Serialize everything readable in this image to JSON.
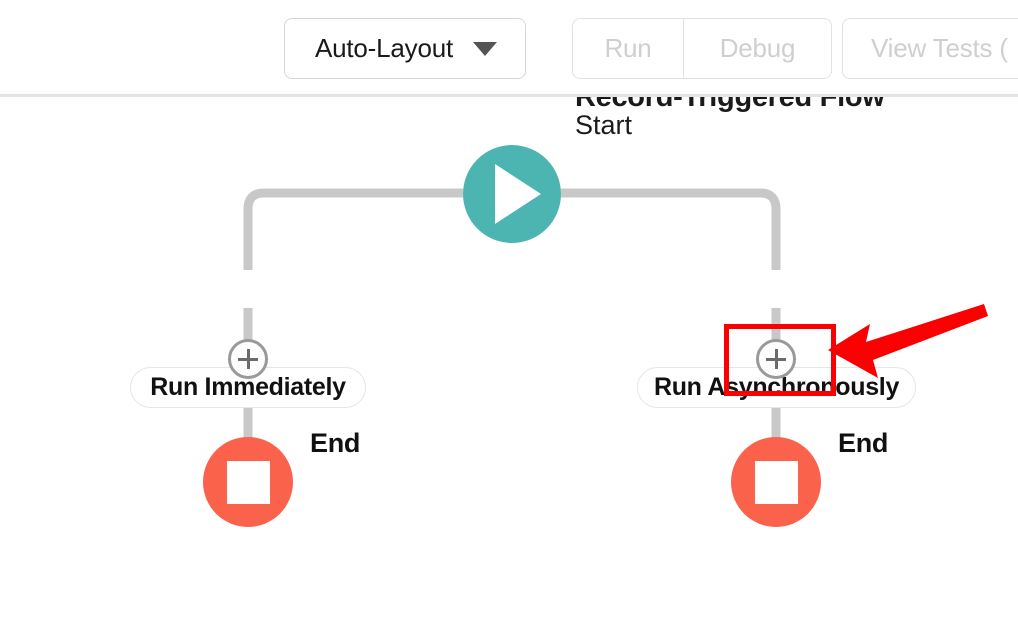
{
  "toolbar": {
    "layout_select": {
      "value": "Auto-Layout",
      "caret_icon": "chevron-down-icon"
    },
    "run_button": {
      "label": "Run",
      "disabled": true
    },
    "debug_button": {
      "label": "Debug",
      "disabled": true
    },
    "view_tests_button": {
      "label": "View Tests (",
      "disabled": true,
      "truncated": true
    }
  },
  "canvas": {
    "flow_title": "Record-Triggered Flow",
    "flow_subtitle": "Start",
    "start_node": {
      "icon": "play-icon",
      "color": "#4cb5b1"
    },
    "branches": [
      {
        "label": "Run Immediately",
        "add_button": {
          "icon": "plus-icon",
          "highlighted": false
        },
        "end_node": {
          "label": "End",
          "icon": "stop-square-icon",
          "color": "#fb624c"
        }
      },
      {
        "label": "Run Asynchronously",
        "add_button": {
          "icon": "plus-icon",
          "highlighted": true
        },
        "end_node": {
          "label": "End",
          "icon": "stop-square-icon",
          "color": "#fb624c"
        }
      }
    ],
    "connector_color": "#c8c8c8"
  },
  "annotation": {
    "highlight_color": "#fb0000",
    "arrow_icon": "arrow-left-icon",
    "target": "Run Asynchronously add element button"
  }
}
